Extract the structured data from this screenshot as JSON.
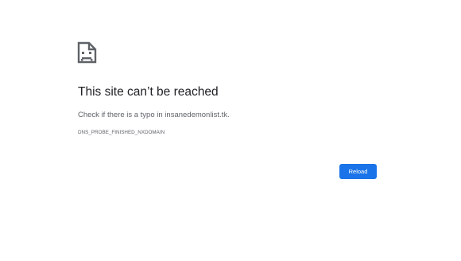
{
  "error_page": {
    "icon": "sad-document-icon",
    "title": "This site can’t be reached",
    "suggestion": "Check if there is a typo in insanedemonlist.tk.",
    "error_code": "DNS_PROBE_FINISHED_NXDOMAIN",
    "reload_label": "Reload"
  },
  "colors": {
    "background": "#ffffff",
    "title_text": "#202124",
    "secondary_text": "#5f6368",
    "button_background": "#1a73e8",
    "button_text": "#ffffff"
  }
}
